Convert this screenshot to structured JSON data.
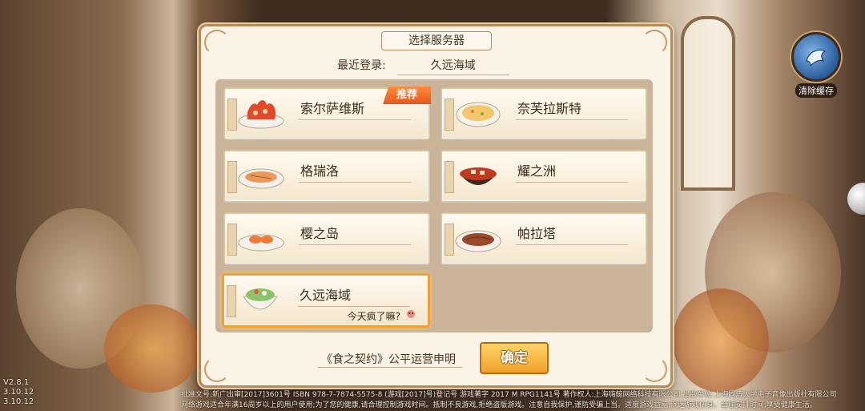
{
  "version": [
    "V2.8.1",
    "3.10.12",
    "3.10.12"
  ],
  "clear_cache": {
    "label": "清除缓存",
    "icon": "dolphin-icon"
  },
  "dialog": {
    "title": "选择服务器",
    "recent_label": "最近登录:",
    "recent_value": "久远海域",
    "servers": [
      {
        "name": "索尔萨维斯",
        "tag": "推荐",
        "dish": "lobster-platter"
      },
      {
        "name": "奈芙拉斯特",
        "dish": "fried-rice"
      },
      {
        "name": "格瑞洛",
        "dish": "fried-fish"
      },
      {
        "name": "耀之洲",
        "dish": "mapo-tofu"
      },
      {
        "name": "樱之岛",
        "dish": "sashimi"
      },
      {
        "name": "帕拉塔",
        "dish": "roast-meat"
      },
      {
        "name": "久远海域",
        "sub": "今天疯了嘛?",
        "dish": "salad-bowl",
        "selected": true
      }
    ],
    "statement": "《食之契约》公平运营申明",
    "confirm_label": "确定"
  },
  "legal": [
    "批准文号:新广出审[2017]3601号 ISBN 978-7-7874-5575-8 (游戏[2017]号)登记号 游戏著字 2017 M RPG1141号 著作权人:上海嗨鲸网络科技有限公司 出版单位:上海同济大学电子音像出版社有限公司",
    "网络游戏适合年满16周岁以上的用户使用;为了您的健康,请合理控制游戏时间。抵制不良游戏,拒绝盗版游戏。注意自我保护,谨防受骗上当。适度游戏益脑,沉迷游戏伤身。合理安排时间,享受健康生活。"
  ],
  "colors": {
    "accent": "#f2a12a",
    "tag": "#e8571c",
    "panel": "#c9b49a",
    "selected_border": "#f0a030"
  }
}
